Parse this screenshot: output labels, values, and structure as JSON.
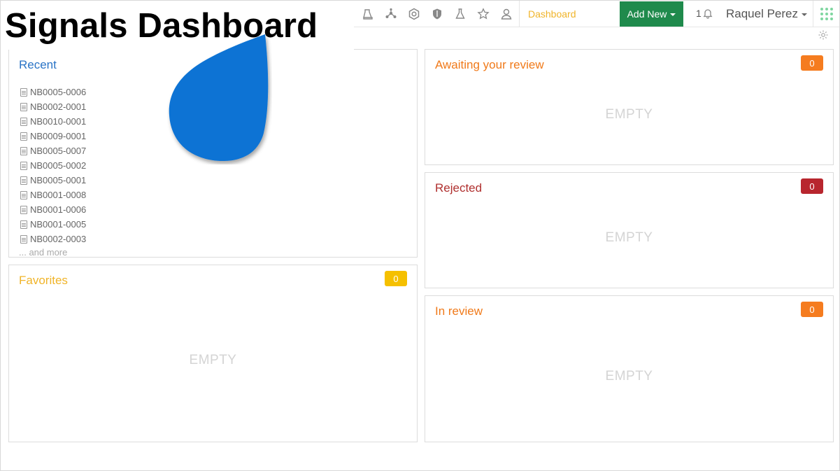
{
  "overlay_title": "Signals Dashboard",
  "nav": {
    "icons": [
      "flask-station-icon",
      "molecule-icon",
      "hexagon-badge-icon",
      "shield-icon",
      "beaker-icon",
      "star-icon",
      "person-icon"
    ],
    "dashboard_label": "Dashboard",
    "add_new_label": "Add New",
    "notification_count": "1",
    "user_name": "Raquel Perez"
  },
  "recent": {
    "title": "Recent",
    "items": [
      "NB0005-0006",
      "NB0002-0001",
      "NB0010-0001",
      "NB0009-0001",
      "NB0005-0007",
      "NB0005-0002",
      "NB0005-0001",
      "NB0001-0008",
      "NB0001-0006",
      "NB0001-0005",
      "NB0002-0003"
    ],
    "more_label": "... and more"
  },
  "favorites": {
    "title": "Favorites",
    "count": "0",
    "empty": "EMPTY"
  },
  "awaiting": {
    "title": "Awaiting your review",
    "count": "0",
    "empty": "EMPTY"
  },
  "rejected": {
    "title": "Rejected",
    "count": "0",
    "empty": "EMPTY"
  },
  "inreview": {
    "title": "In review",
    "count": "0",
    "empty": "EMPTY"
  },
  "colors": {
    "brand_green": "#1f8a4c",
    "recent_blue": "#2a74c6",
    "favorites_yellow": "#f0b429",
    "orange": "#f57c1f",
    "rejected_red": "#b8262e",
    "drop_blue": "#0a73d4"
  }
}
